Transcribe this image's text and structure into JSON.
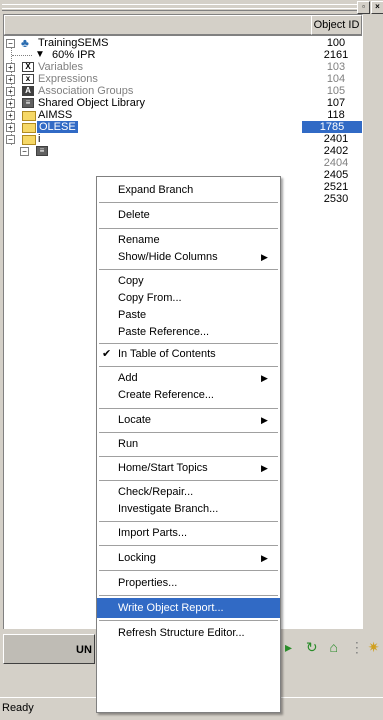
{
  "window": {
    "close_glyph": "×",
    "restore_glyph": "▫"
  },
  "columns": {
    "object_id": "Object ID"
  },
  "tree": [
    {
      "label": "TrainingSEMS",
      "id": "100",
      "grey": false
    },
    {
      "label": "60% IPR",
      "id": "2161",
      "grey": false
    },
    {
      "label": "Variables",
      "id": "103",
      "grey": true
    },
    {
      "label": "Expressions",
      "id": "104",
      "grey": true
    },
    {
      "label": "Association Groups",
      "id": "105",
      "grey": true
    },
    {
      "label": "Shared Object Library",
      "id": "107",
      "grey": false
    },
    {
      "label": "AIMSS",
      "id": "118",
      "grey": false
    },
    {
      "label": "OLESE",
      "id": "1785",
      "grey": false
    },
    {
      "label": "i",
      "id": "2401",
      "grey": false
    },
    {
      "label": "",
      "id": "2402",
      "grey": false
    },
    {
      "label": "",
      "id": "2404",
      "grey": true
    },
    {
      "label": "",
      "id": "2405",
      "grey": false
    },
    {
      "label": "",
      "id": "2521",
      "grey": false
    },
    {
      "label": "",
      "id": "2530",
      "grey": false
    }
  ],
  "menu": {
    "expand_branch": "Expand Branch",
    "delete": "Delete",
    "rename": "Rename",
    "show_hide_columns": "Show/Hide Columns",
    "copy": "Copy",
    "copy_from": "Copy From...",
    "paste": "Paste",
    "paste_reference": "Paste Reference...",
    "in_table_of_contents": "In Table of Contents",
    "add": "Add",
    "create_reference": "Create Reference...",
    "locate": "Locate",
    "run": "Run",
    "home_start_topics": "Home/Start Topics",
    "check_repair": "Check/Repair...",
    "investigate_branch": "Investigate Branch...",
    "import_parts": "Import Parts...",
    "locking": "Locking",
    "properties": "Properties...",
    "write_object_report": "Write Object Report...",
    "refresh_structure_editor": "Refresh Structure Editor...",
    "submenu_arrow": "▶",
    "check_mark": "✔"
  },
  "toolbar": {
    "button_label": "UN"
  },
  "status": {
    "text": "Ready"
  },
  "colors": {
    "selection": "#316ac5",
    "face": "#d4d0c8"
  }
}
